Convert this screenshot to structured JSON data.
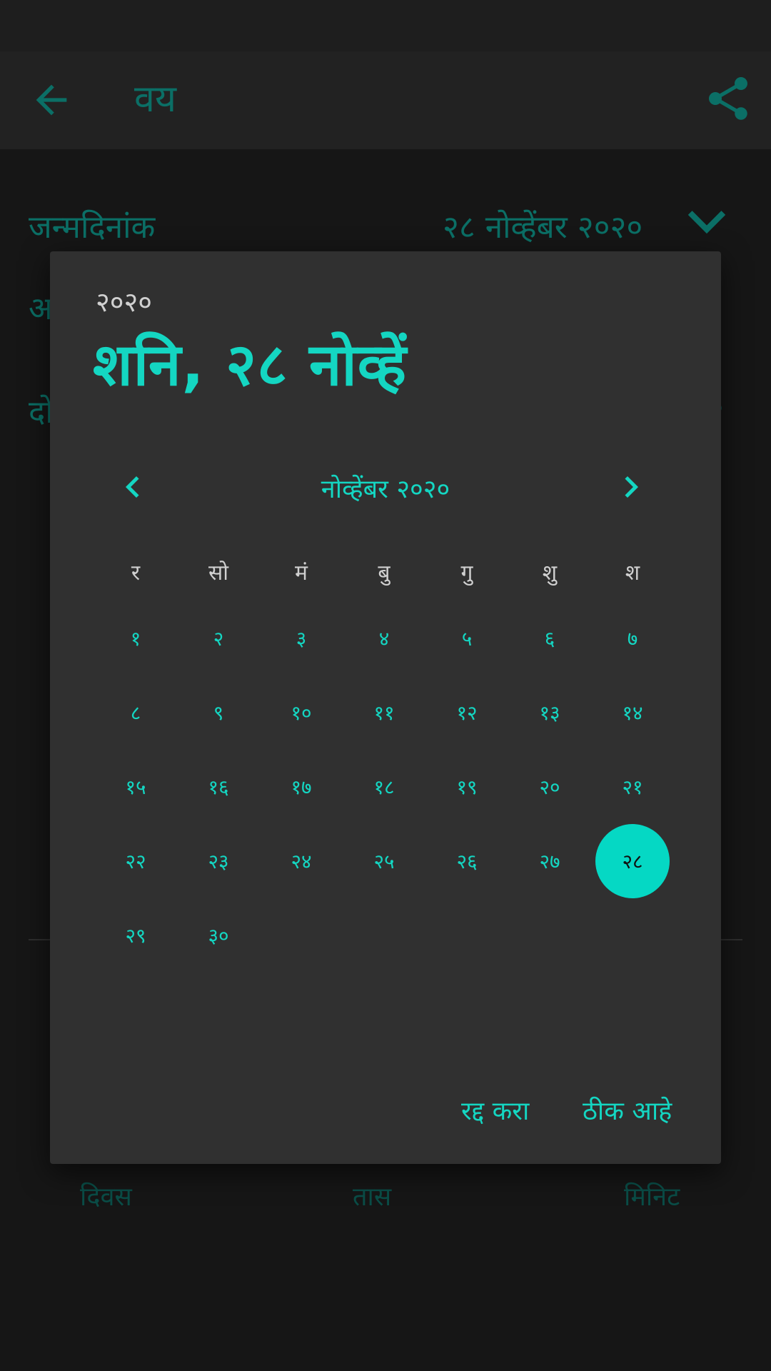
{
  "app_bar": {
    "title": "वय",
    "back_icon": "arrow-back-icon",
    "share_icon": "share-icon"
  },
  "background": {
    "birthdate_label": "जन्मदिनांक",
    "birthdate_value": "२८ नोव्हेंबर २०२०",
    "row2_fragment": "अ",
    "row3_fragment": "दो",
    "row3_right_fragment": "०",
    "stat_labels": [
      "दिवस",
      "तास",
      "मिनिट"
    ]
  },
  "dialog": {
    "year": "२०२०",
    "selected_date": "शनि, २८ नोव्हें",
    "month_title": "नोव्हेंबर २०२०",
    "weekdays": [
      "र",
      "सो",
      "मं",
      "बु",
      "गु",
      "शु",
      "श"
    ],
    "days": [
      "१",
      "२",
      "३",
      "४",
      "५",
      "६",
      "७",
      "८",
      "९",
      "१०",
      "११",
      "१२",
      "१३",
      "१४",
      "१५",
      "१६",
      "१७",
      "१८",
      "१९",
      "२०",
      "२१",
      "२२",
      "२३",
      "२४",
      "२५",
      "२६",
      "२७",
      "२८",
      "२९",
      "३०"
    ],
    "selected_day": "२८",
    "cancel_label": "रद्द करा",
    "ok_label": "ठीक आहे"
  },
  "colors": {
    "accent": "#14d6c2",
    "dialog_bg": "#303030",
    "app_bar_bg": "#222222"
  }
}
